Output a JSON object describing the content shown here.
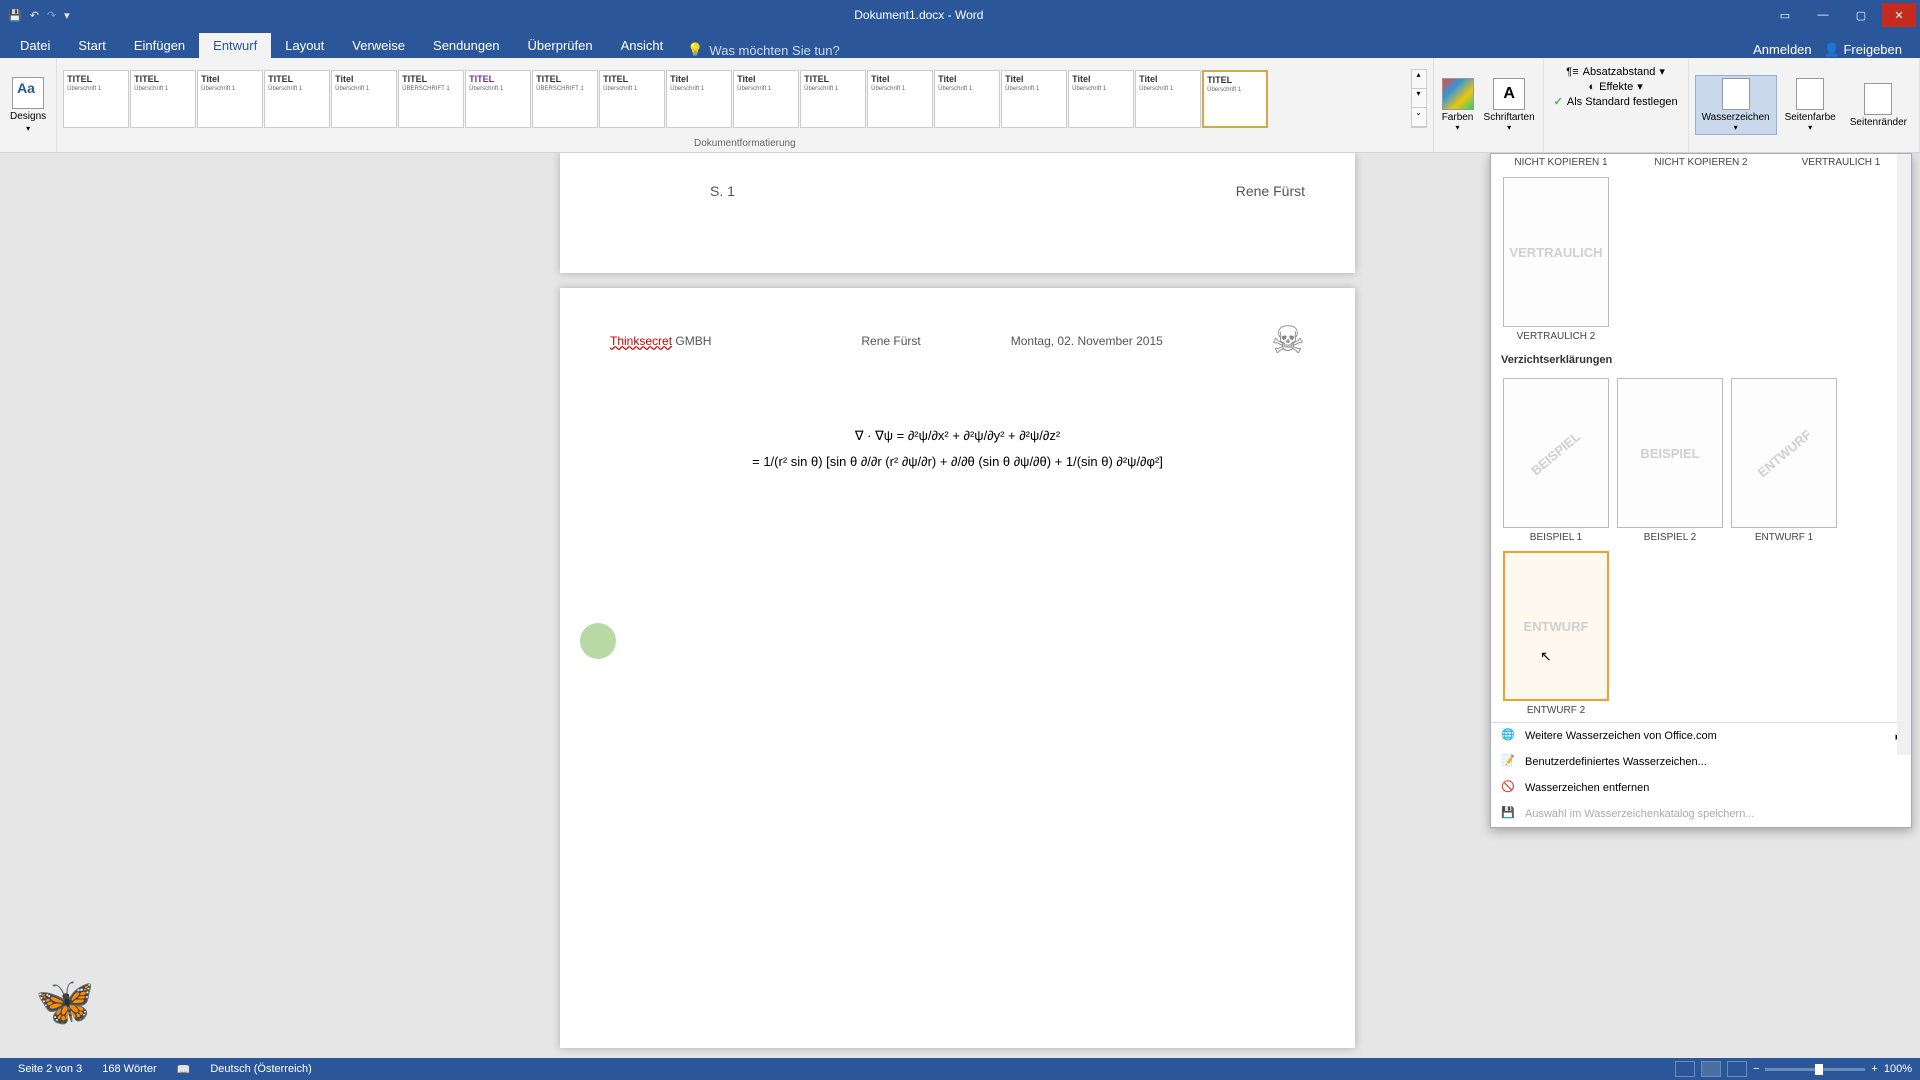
{
  "titlebar": {
    "title": "Dokument1.docx - Word"
  },
  "tabs": {
    "datei": "Datei",
    "start": "Start",
    "einfuegen": "Einfügen",
    "entwurf": "Entwurf",
    "layout": "Layout",
    "verweise": "Verweise",
    "sendungen": "Sendungen",
    "ueberpruefen": "Überprüfen",
    "ansicht": "Ansicht",
    "search_placeholder": "Was möchten Sie tun?",
    "anmelden": "Anmelden",
    "freigeben": "Freigeben"
  },
  "ribbon": {
    "designs": "Designs",
    "doc_formatting_label": "Dokumentformatierung",
    "formats": [
      {
        "title": "TITEL",
        "sub": "Überschrift 1"
      },
      {
        "title": "TITEL",
        "sub": "Überschrift 1"
      },
      {
        "title": "Titel",
        "sub": "Überschrift 1"
      },
      {
        "title": "TITEL",
        "sub": "Überschrift 1"
      },
      {
        "title": "Titel",
        "sub": "Überschrift 1"
      },
      {
        "title": "TITEL",
        "sub": "ÜBERSCHRIFT 1"
      },
      {
        "title": "TITEL",
        "sub": "Überschrift 1",
        "purple": true
      },
      {
        "title": "TITEL",
        "sub": "ÜBERSCHRIFT 1"
      },
      {
        "title": "TITEL",
        "sub": "Überschrift 1"
      },
      {
        "title": "Titel",
        "sub": "Überschrift 1"
      },
      {
        "title": "Titel",
        "sub": "Überschrift 1"
      },
      {
        "title": "TITEL",
        "sub": "Überschrift 1"
      },
      {
        "title": "Titel",
        "sub": "Überschrift 1"
      },
      {
        "title": "Titel",
        "sub": "Überschrift 1"
      },
      {
        "title": "Titel",
        "sub": "Überschrift 1"
      },
      {
        "title": "Titel",
        "sub": "Überschrift 1"
      },
      {
        "title": "Titel",
        "sub": "Überschrift 1"
      },
      {
        "title": "TITEL",
        "sub": "Überschrift 1",
        "selected": true
      }
    ],
    "farben": "Farben",
    "schriftarten": "Schriftarten",
    "absatzabstand": "Absatzabstand",
    "effekte": "Effekte",
    "als_standard": "Als Standard festlegen",
    "wasserzeichen": "Wasserzeichen",
    "seitenfarbe": "Seitenfarbe",
    "seitenraender": "Seitenränder"
  },
  "document": {
    "page1": {
      "pagenum": "S. 1",
      "author": "Rene Fürst"
    },
    "page2": {
      "company": "Thinksecret",
      "company_suffix": " GMBH",
      "author": "Rene Fürst",
      "date": "Montag, 02. November 2015",
      "equation_line1": "∇ · ∇ψ = ∂²ψ/∂x² + ∂²ψ/∂y² + ∂²ψ/∂z²",
      "equation_line2": "= 1/(r² sin θ) [sin θ ∂/∂r (r² ∂ψ/∂r) + ∂/∂θ (sin θ ∂ψ/∂θ) + 1/(sin θ) ∂²ψ/∂φ²]"
    }
  },
  "watermark_panel": {
    "top_labels": [
      "NICHT KOPIEREN 1",
      "NICHT KOPIEREN 2",
      "VERTRAULICH 1"
    ],
    "vertraulich2_text": "VERTRAULICH",
    "vertraulich2_label": "VERTRAULICH 2",
    "section2": "Verzichtserklärungen",
    "items2": [
      {
        "text": "BEISPIEL",
        "label": "BEISPIEL 1"
      },
      {
        "text": "BEISPIEL",
        "label": "BEISPIEL 2",
        "straight": true
      },
      {
        "text": "ENTWURF",
        "label": "ENTWURF 1"
      },
      {
        "text": "ENTWURF",
        "label": "ENTWURF 2",
        "straight": true,
        "hover": true
      }
    ],
    "menu": {
      "more": "Weitere Wasserzeichen von Office.com",
      "custom": "Benutzerdefiniertes Wasserzeichen...",
      "remove": "Wasserzeichen entfernen",
      "save": "Auswahl im Wasserzeichenkatalog speichern..."
    }
  },
  "statusbar": {
    "page": "Seite 2 von 3",
    "words": "168 Wörter",
    "language": "Deutsch (Österreich)",
    "zoom": "100%"
  }
}
